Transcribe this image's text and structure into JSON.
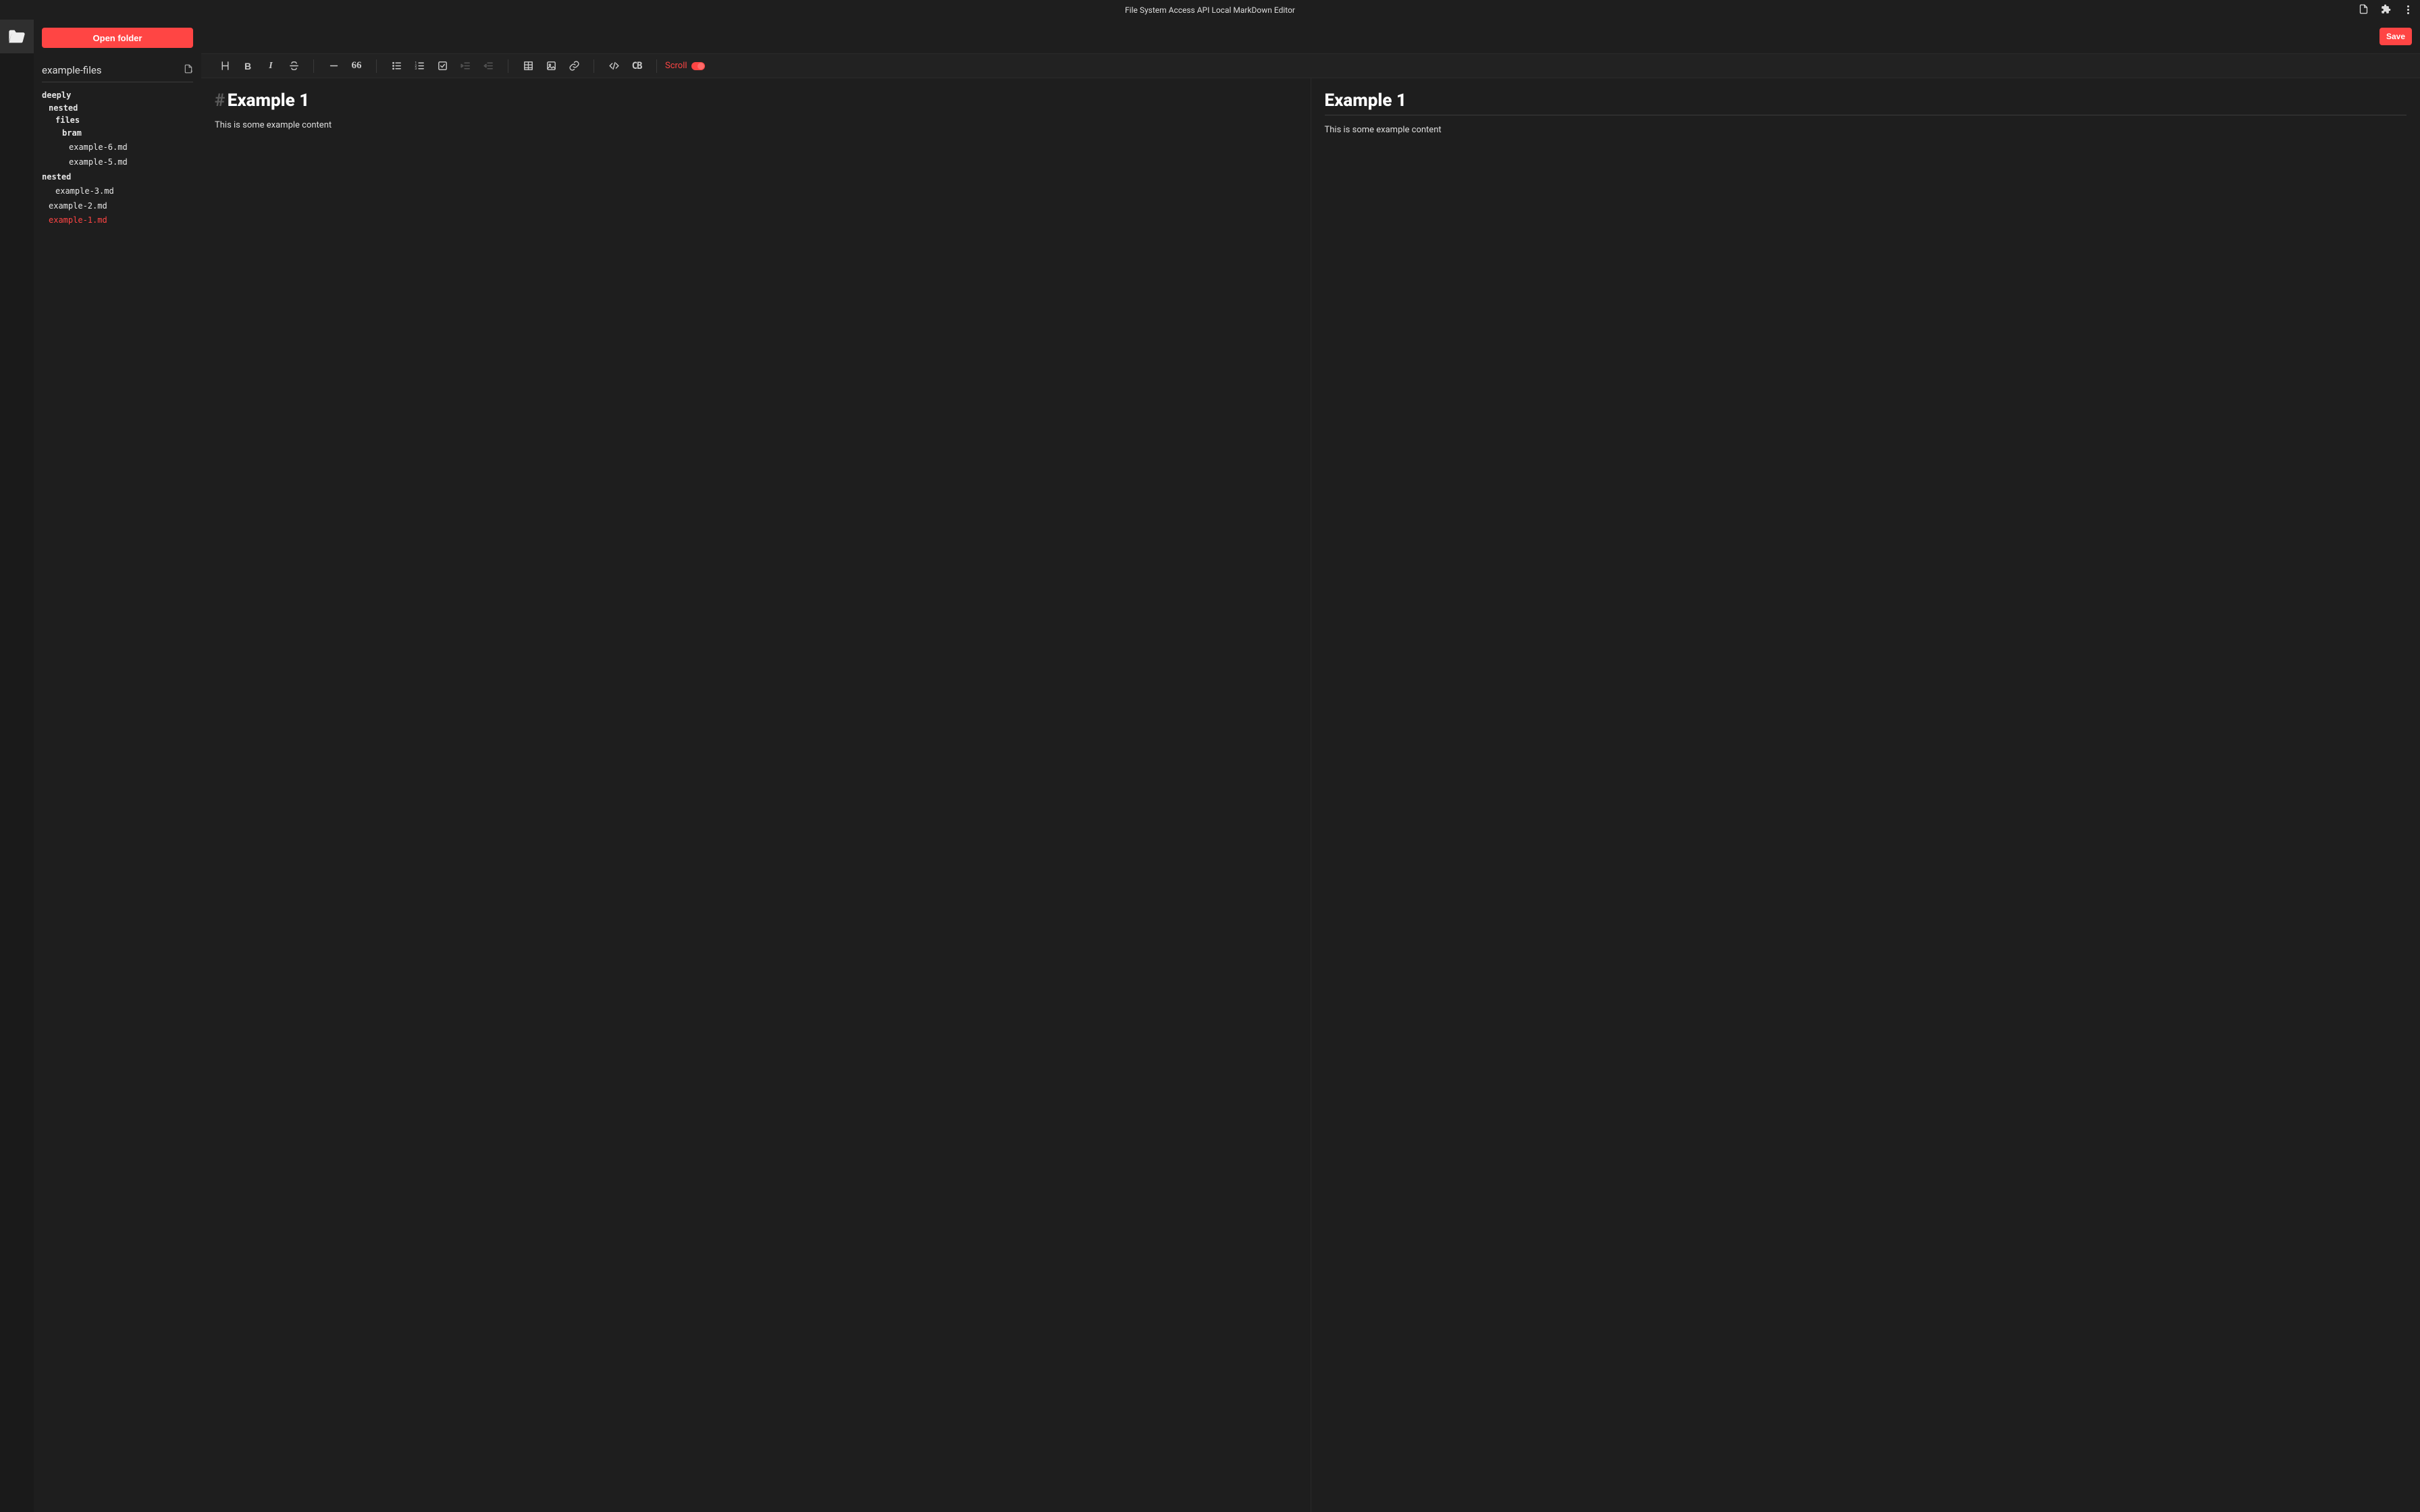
{
  "titlebar": {
    "title": "File System Access API Local MarkDown Editor"
  },
  "sidebar": {
    "open_folder": "Open folder",
    "folder_name": "example-files",
    "tree": [
      {
        "type": "folder",
        "label": "deeply",
        "depth": 0
      },
      {
        "type": "folder",
        "label": "nested",
        "depth": 1
      },
      {
        "type": "folder",
        "label": "files",
        "depth": 2
      },
      {
        "type": "folder",
        "label": "bram",
        "depth": 3
      },
      {
        "type": "file",
        "label": "example-6.md",
        "depth": 3,
        "spaced": true
      },
      {
        "type": "file",
        "label": "example-5.md",
        "depth": 3,
        "spaced": true
      },
      {
        "type": "folder",
        "label": "nested",
        "depth": 0,
        "spaced": true
      },
      {
        "type": "file",
        "label": "example-3.md",
        "depth": 1,
        "spaced": true
      },
      {
        "type": "file",
        "label": "example-2.md",
        "depth": 0,
        "spaced": true
      },
      {
        "type": "file",
        "label": "example-1.md",
        "depth": 0,
        "active": true,
        "spaced": true
      }
    ]
  },
  "topbar": {
    "save": "Save"
  },
  "toolbar": {
    "scroll_label": "Scroll"
  },
  "editor": {
    "hash": "#",
    "heading": "Example 1",
    "body": "This is some example content"
  },
  "preview": {
    "heading": "Example 1",
    "body": "This is some example content"
  }
}
